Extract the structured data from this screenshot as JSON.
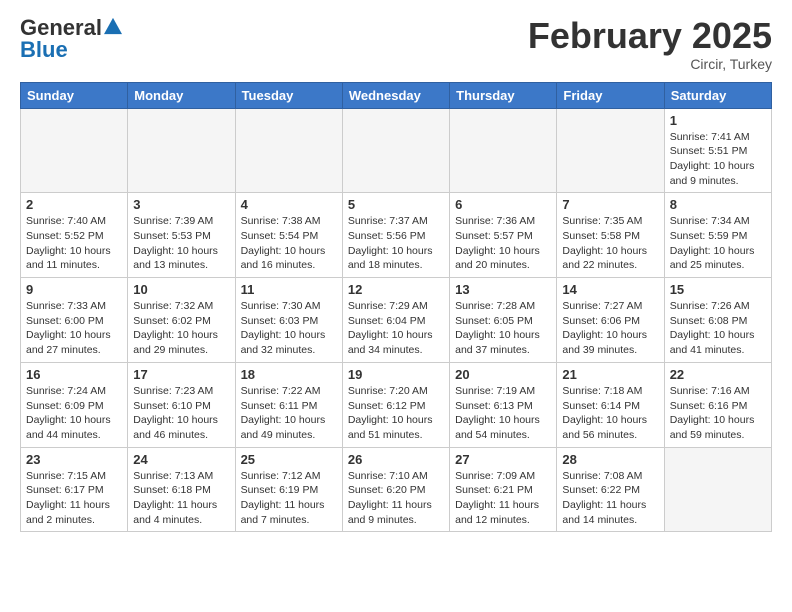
{
  "header": {
    "logo_line1": "General",
    "logo_line2": "Blue",
    "month": "February 2025",
    "location": "Circir, Turkey"
  },
  "weekdays": [
    "Sunday",
    "Monday",
    "Tuesday",
    "Wednesday",
    "Thursday",
    "Friday",
    "Saturday"
  ],
  "weeks": [
    [
      {
        "day": "",
        "info": ""
      },
      {
        "day": "",
        "info": ""
      },
      {
        "day": "",
        "info": ""
      },
      {
        "day": "",
        "info": ""
      },
      {
        "day": "",
        "info": ""
      },
      {
        "day": "",
        "info": ""
      },
      {
        "day": "1",
        "info": "Sunrise: 7:41 AM\nSunset: 5:51 PM\nDaylight: 10 hours\nand 9 minutes."
      }
    ],
    [
      {
        "day": "2",
        "info": "Sunrise: 7:40 AM\nSunset: 5:52 PM\nDaylight: 10 hours\nand 11 minutes."
      },
      {
        "day": "3",
        "info": "Sunrise: 7:39 AM\nSunset: 5:53 PM\nDaylight: 10 hours\nand 13 minutes."
      },
      {
        "day": "4",
        "info": "Sunrise: 7:38 AM\nSunset: 5:54 PM\nDaylight: 10 hours\nand 16 minutes."
      },
      {
        "day": "5",
        "info": "Sunrise: 7:37 AM\nSunset: 5:56 PM\nDaylight: 10 hours\nand 18 minutes."
      },
      {
        "day": "6",
        "info": "Sunrise: 7:36 AM\nSunset: 5:57 PM\nDaylight: 10 hours\nand 20 minutes."
      },
      {
        "day": "7",
        "info": "Sunrise: 7:35 AM\nSunset: 5:58 PM\nDaylight: 10 hours\nand 22 minutes."
      },
      {
        "day": "8",
        "info": "Sunrise: 7:34 AM\nSunset: 5:59 PM\nDaylight: 10 hours\nand 25 minutes."
      }
    ],
    [
      {
        "day": "9",
        "info": "Sunrise: 7:33 AM\nSunset: 6:00 PM\nDaylight: 10 hours\nand 27 minutes."
      },
      {
        "day": "10",
        "info": "Sunrise: 7:32 AM\nSunset: 6:02 PM\nDaylight: 10 hours\nand 29 minutes."
      },
      {
        "day": "11",
        "info": "Sunrise: 7:30 AM\nSunset: 6:03 PM\nDaylight: 10 hours\nand 32 minutes."
      },
      {
        "day": "12",
        "info": "Sunrise: 7:29 AM\nSunset: 6:04 PM\nDaylight: 10 hours\nand 34 minutes."
      },
      {
        "day": "13",
        "info": "Sunrise: 7:28 AM\nSunset: 6:05 PM\nDaylight: 10 hours\nand 37 minutes."
      },
      {
        "day": "14",
        "info": "Sunrise: 7:27 AM\nSunset: 6:06 PM\nDaylight: 10 hours\nand 39 minutes."
      },
      {
        "day": "15",
        "info": "Sunrise: 7:26 AM\nSunset: 6:08 PM\nDaylight: 10 hours\nand 41 minutes."
      }
    ],
    [
      {
        "day": "16",
        "info": "Sunrise: 7:24 AM\nSunset: 6:09 PM\nDaylight: 10 hours\nand 44 minutes."
      },
      {
        "day": "17",
        "info": "Sunrise: 7:23 AM\nSunset: 6:10 PM\nDaylight: 10 hours\nand 46 minutes."
      },
      {
        "day": "18",
        "info": "Sunrise: 7:22 AM\nSunset: 6:11 PM\nDaylight: 10 hours\nand 49 minutes."
      },
      {
        "day": "19",
        "info": "Sunrise: 7:20 AM\nSunset: 6:12 PM\nDaylight: 10 hours\nand 51 minutes."
      },
      {
        "day": "20",
        "info": "Sunrise: 7:19 AM\nSunset: 6:13 PM\nDaylight: 10 hours\nand 54 minutes."
      },
      {
        "day": "21",
        "info": "Sunrise: 7:18 AM\nSunset: 6:14 PM\nDaylight: 10 hours\nand 56 minutes."
      },
      {
        "day": "22",
        "info": "Sunrise: 7:16 AM\nSunset: 6:16 PM\nDaylight: 10 hours\nand 59 minutes."
      }
    ],
    [
      {
        "day": "23",
        "info": "Sunrise: 7:15 AM\nSunset: 6:17 PM\nDaylight: 11 hours\nand 2 minutes."
      },
      {
        "day": "24",
        "info": "Sunrise: 7:13 AM\nSunset: 6:18 PM\nDaylight: 11 hours\nand 4 minutes."
      },
      {
        "day": "25",
        "info": "Sunrise: 7:12 AM\nSunset: 6:19 PM\nDaylight: 11 hours\nand 7 minutes."
      },
      {
        "day": "26",
        "info": "Sunrise: 7:10 AM\nSunset: 6:20 PM\nDaylight: 11 hours\nand 9 minutes."
      },
      {
        "day": "27",
        "info": "Sunrise: 7:09 AM\nSunset: 6:21 PM\nDaylight: 11 hours\nand 12 minutes."
      },
      {
        "day": "28",
        "info": "Sunrise: 7:08 AM\nSunset: 6:22 PM\nDaylight: 11 hours\nand 14 minutes."
      },
      {
        "day": "",
        "info": ""
      }
    ]
  ]
}
